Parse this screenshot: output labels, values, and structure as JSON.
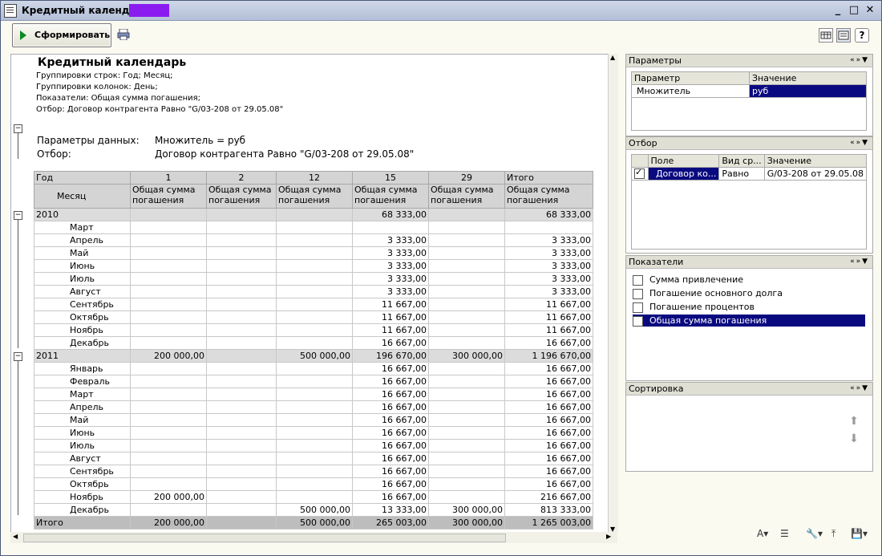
{
  "window": {
    "title": "Кредитный календарь"
  },
  "toolbar": {
    "generate_label": "Сформировать"
  },
  "report": {
    "title": "Кредитный календарь",
    "lines": [
      "Группировки строк: Год; Месяц;",
      "Группировки колонок: День;",
      "Показатели: Общая сумма погашения;",
      "Отбор: Договор контрагента Равно \"G/03-208 от 29.05.08\""
    ],
    "params_label": "Параметры данных:",
    "params_value": "Множитель = руб",
    "filter_label": "Отбор:",
    "filter_value": "Договор контрагента Равно \"G/03-208 от 29.05.08\"",
    "header_year": "Год",
    "header_month": "Месяц",
    "columns": [
      "1",
      "2",
      "12",
      "15",
      "29",
      "Итого"
    ],
    "column_sub": "Общая сумма погашения",
    "rows": [
      {
        "label": "2010",
        "type": "year",
        "v": [
          "",
          "",
          "",
          "68 333,00",
          "",
          "68 333,00"
        ]
      },
      {
        "label": "Март",
        "type": "month",
        "v": [
          "",
          "",
          "",
          "",
          "",
          ""
        ]
      },
      {
        "label": "Апрель",
        "type": "month",
        "v": [
          "",
          "",
          "",
          "3 333,00",
          "",
          "3 333,00"
        ]
      },
      {
        "label": "Май",
        "type": "month",
        "v": [
          "",
          "",
          "",
          "3 333,00",
          "",
          "3 333,00"
        ]
      },
      {
        "label": "Июнь",
        "type": "month",
        "v": [
          "",
          "",
          "",
          "3 333,00",
          "",
          "3 333,00"
        ]
      },
      {
        "label": "Июль",
        "type": "month",
        "v": [
          "",
          "",
          "",
          "3 333,00",
          "",
          "3 333,00"
        ]
      },
      {
        "label": "Август",
        "type": "month",
        "v": [
          "",
          "",
          "",
          "3 333,00",
          "",
          "3 333,00"
        ]
      },
      {
        "label": "Сентябрь",
        "type": "month",
        "v": [
          "",
          "",
          "",
          "11 667,00",
          "",
          "11 667,00"
        ]
      },
      {
        "label": "Октябрь",
        "type": "month",
        "v": [
          "",
          "",
          "",
          "11 667,00",
          "",
          "11 667,00"
        ]
      },
      {
        "label": "Ноябрь",
        "type": "month",
        "v": [
          "",
          "",
          "",
          "11 667,00",
          "",
          "11 667,00"
        ]
      },
      {
        "label": "Декабрь",
        "type": "month",
        "v": [
          "",
          "",
          "",
          "16 667,00",
          "",
          "16 667,00"
        ]
      },
      {
        "label": "2011",
        "type": "year",
        "v": [
          "200 000,00",
          "",
          "500 000,00",
          "196 670,00",
          "300 000,00",
          "1 196 670,00"
        ]
      },
      {
        "label": "Январь",
        "type": "month",
        "v": [
          "",
          "",
          "",
          "16 667,00",
          "",
          "16 667,00"
        ]
      },
      {
        "label": "Февраль",
        "type": "month",
        "v": [
          "",
          "",
          "",
          "16 667,00",
          "",
          "16 667,00"
        ]
      },
      {
        "label": "Март",
        "type": "month",
        "v": [
          "",
          "",
          "",
          "16 667,00",
          "",
          "16 667,00"
        ]
      },
      {
        "label": "Апрель",
        "type": "month",
        "v": [
          "",
          "",
          "",
          "16 667,00",
          "",
          "16 667,00"
        ]
      },
      {
        "label": "Май",
        "type": "month",
        "v": [
          "",
          "",
          "",
          "16 667,00",
          "",
          "16 667,00"
        ]
      },
      {
        "label": "Июнь",
        "type": "month",
        "v": [
          "",
          "",
          "",
          "16 667,00",
          "",
          "16 667,00"
        ]
      },
      {
        "label": "Июль",
        "type": "month",
        "v": [
          "",
          "",
          "",
          "16 667,00",
          "",
          "16 667,00"
        ]
      },
      {
        "label": "Август",
        "type": "month",
        "v": [
          "",
          "",
          "",
          "16 667,00",
          "",
          "16 667,00"
        ]
      },
      {
        "label": "Сентябрь",
        "type": "month",
        "v": [
          "",
          "",
          "",
          "16 667,00",
          "",
          "16 667,00"
        ]
      },
      {
        "label": "Октябрь",
        "type": "month",
        "v": [
          "",
          "",
          "",
          "16 667,00",
          "",
          "16 667,00"
        ]
      },
      {
        "label": "Ноябрь",
        "type": "month",
        "v": [
          "200 000,00",
          "",
          "",
          "16 667,00",
          "",
          "216 667,00"
        ]
      },
      {
        "label": "Декабрь",
        "type": "month",
        "v": [
          "",
          "",
          "500 000,00",
          "13 333,00",
          "300 000,00",
          "813 333,00"
        ]
      },
      {
        "label": "Итого",
        "type": "total",
        "v": [
          "200 000,00",
          "",
          "500 000,00",
          "265 003,00",
          "300 000,00",
          "1 265 003,00"
        ]
      }
    ]
  },
  "panels": {
    "params": {
      "title": "Параметры",
      "col_param": "Параметр",
      "col_value": "Значение",
      "row_param": "Множитель",
      "row_value": "руб"
    },
    "filter": {
      "title": "Отбор",
      "col_field": "Поле",
      "col_kind": "Вид ср...",
      "col_value": "Значение",
      "row_field": "Договор ко...",
      "row_kind": "Равно",
      "row_value": "G/03-208 от 29.05.08"
    },
    "indicators": {
      "title": "Показатели",
      "items": [
        {
          "label": "Сумма привлечение",
          "checked": false
        },
        {
          "label": "Погашение основного долга",
          "checked": false
        },
        {
          "label": "Погашение процентов",
          "checked": false
        },
        {
          "label": "Общая сумма погашения",
          "checked": true
        }
      ]
    },
    "sort": {
      "title": "Сортировка"
    }
  },
  "colors": {
    "selection": "#0a0a80",
    "title_mark": "#8a1cf0"
  }
}
